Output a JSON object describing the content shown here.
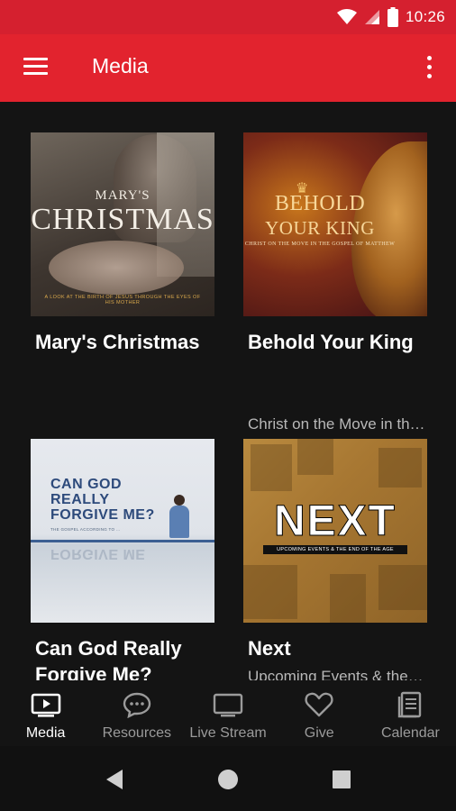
{
  "status_bar": {
    "time": "10:26"
  },
  "app_bar": {
    "title": "Media"
  },
  "cards": [
    {
      "title": "Mary's Christmas",
      "subtitle": "",
      "art_title_top": "MARY'S",
      "art_title_main": "CHRISTMAS",
      "art_tagline": "A LOOK AT THE BIRTH OF JESUS THROUGH THE EYES OF HIS MOTHER"
    },
    {
      "title": "Behold Your King",
      "subtitle": "Christ on the Move in the Gospel of Matthew",
      "art_title_1": "BEHOLD",
      "art_title_2": "YOUR KING",
      "art_subtitle": "CHRIST ON THE MOVE IN THE GOSPEL OF MATTHEW"
    },
    {
      "title": "Can God Really Forgive Me?",
      "subtitle": "",
      "art_title": "CAN GOD REALLY FORGIVE ME?",
      "art_subtitle": "THE GOSPEL ACCORDING TO ...",
      "art_reflection": "FORGIVE ME"
    },
    {
      "title": "Next",
      "subtitle": "Upcoming Events & the End of the Age",
      "art_title": "NEXT",
      "art_subtitle": "UPCOMING EVENTS & THE END OF THE AGE"
    }
  ],
  "bottom_nav": [
    {
      "label": "Media",
      "icon": "tv-play-icon",
      "active": true
    },
    {
      "label": "Resources",
      "icon": "chat-bubble-icon",
      "active": false
    },
    {
      "label": "Live Stream",
      "icon": "monitor-icon",
      "active": false
    },
    {
      "label": "Give",
      "icon": "heart-icon",
      "active": false
    },
    {
      "label": "Calendar",
      "icon": "calendar-icon",
      "active": false
    }
  ],
  "system_nav": {
    "back": "back-icon",
    "home": "home-icon",
    "recents": "recents-icon"
  },
  "colors": {
    "app_bar": "#e2232e",
    "status_bar": "#d5202f",
    "background": "#141414",
    "subtitle": "#b8b8b8"
  }
}
